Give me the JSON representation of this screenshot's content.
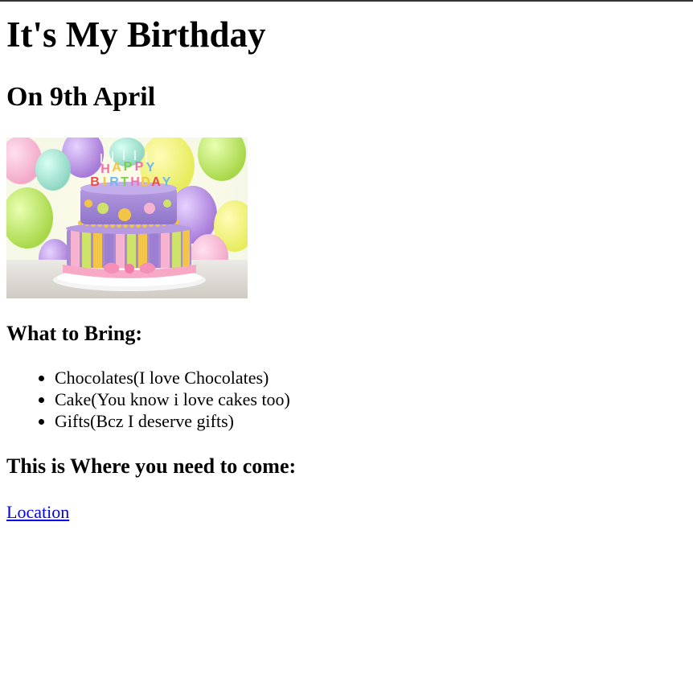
{
  "page": {
    "title": "It's My Birthday",
    "subtitle": "On 9th April",
    "image": {
      "subject": "birthday-cake",
      "candle_text": "HAPPY BIRTHDAY"
    },
    "bring_heading": "What to Bring:",
    "bring_items": [
      "Chocolates(I love Chocolates)",
      "Cake(You know i love cakes too)",
      "Gifts(Bcz I deserve gifts)"
    ],
    "where_heading": "This is Where you need to come:",
    "location_link": "Location"
  },
  "colors": {
    "link": "#0000ee",
    "text": "#000000",
    "background": "#ffffff"
  }
}
